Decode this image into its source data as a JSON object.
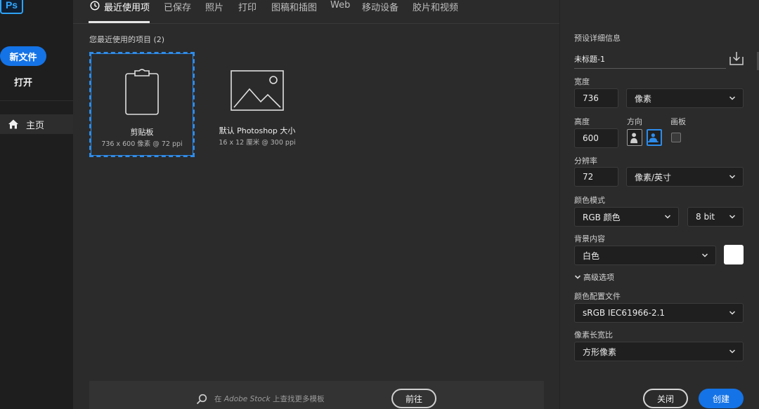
{
  "app": {
    "logo": "Ps",
    "accent_color": "#1473e6"
  },
  "sidebar": {
    "new_file_label": "新文件",
    "open_label": "打开",
    "home_label": "主页",
    "home_icon": "home-icon"
  },
  "tabs": [
    {
      "label": "最近使用项",
      "active": true,
      "icon": "clock-icon"
    },
    {
      "label": "已保存"
    },
    {
      "label": "照片"
    },
    {
      "label": "打印"
    },
    {
      "label": "图稿和插图"
    },
    {
      "label": "Web"
    },
    {
      "label": "移动设备"
    },
    {
      "label": "胶片和视频"
    }
  ],
  "recent": {
    "title": "您最近使用的项目 (2)",
    "items": [
      {
        "name": "剪贴板",
        "meta": "736 x 600 像素 @ 72 ppi",
        "icon": "clipboard-icon",
        "selected": true
      },
      {
        "name": "默认 Photoshop 大小",
        "meta": "16 x 12 厘米 @ 300 ppi",
        "icon": "image-icon",
        "selected": false
      }
    ]
  },
  "stock": {
    "prefix": "在 ",
    "brand": "Adobe Stock",
    "suffix": " 上查找更多模板",
    "go_label": "前往"
  },
  "details": {
    "section_label": "预设详细信息",
    "preset_name": "未标题-1",
    "width_label": "宽度",
    "width_value": "736",
    "width_unit": "像素",
    "height_label": "高度",
    "height_value": "600",
    "orientation_label": "方向",
    "artboard_label": "画板",
    "artboard_checked": false,
    "resolution_label": "分辨率",
    "resolution_value": "72",
    "resolution_unit": "像素/英寸",
    "color_mode_label": "颜色模式",
    "color_mode_value": "RGB 颜色",
    "bit_depth": "8 bit",
    "background_label": "背景内容",
    "background_value": "白色",
    "background_color": "#ffffff",
    "advanced_label": "高级选项",
    "color_profile_label": "颜色配置文件",
    "color_profile_value": "sRGB IEC61966-2.1",
    "pixel_aspect_label": "像素长宽比",
    "pixel_aspect_value": "方形像素",
    "close_label": "关闭",
    "create_label": "创建"
  }
}
